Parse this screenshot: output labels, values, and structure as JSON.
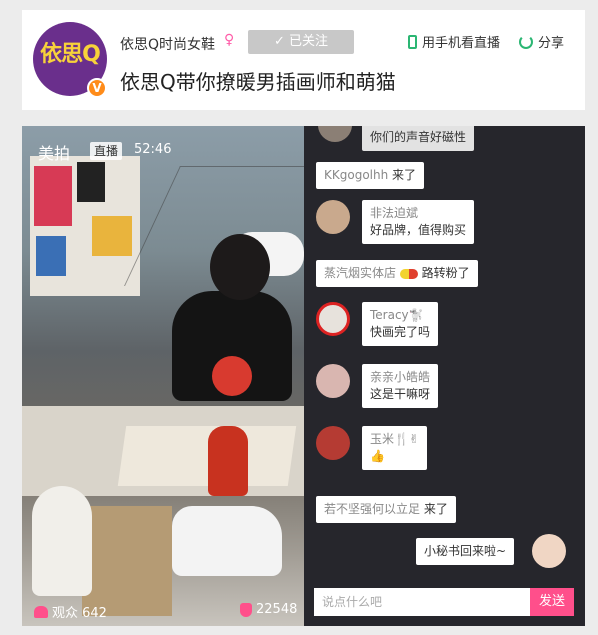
{
  "header": {
    "avatar_text": "依思Q",
    "verified_badge": "V",
    "channel_name": "依思Q时尚女鞋",
    "gender_icon": "♀",
    "follow_label": "✓ 已关注",
    "phone_watch_label": "用手机看直播",
    "share_label": "分享",
    "live_title": "依思Q带你撩暖男插画师和萌猫"
  },
  "video": {
    "brand": "美拍",
    "live_badge": "直播",
    "elapsed": "52:46",
    "viewers_label": "观众 642",
    "likes": "22548"
  },
  "chat": {
    "messages": [
      {
        "user": "",
        "text": "你们的声音好磁性"
      },
      {
        "user": "KKgogolhh",
        "text": "来了"
      },
      {
        "user": "非法迫斌",
        "text": "好品牌，值得购买"
      },
      {
        "user": "蒸汽烟实体店",
        "text": "路转粉了"
      },
      {
        "user": "Teracy🐩",
        "text": "快画完了吗"
      },
      {
        "user": "亲亲小皓皓",
        "text": "这是干嘛呀"
      },
      {
        "user": "玉米🍴✌",
        "text": "👍"
      },
      {
        "user": "若不坚强何以立足",
        "text": "来了"
      },
      {
        "user": "",
        "text": "小秘书回来啦~"
      }
    ],
    "input_placeholder": "说点什么吧",
    "send_label": "发送"
  },
  "colors": {
    "accent_pink": "#ff4f8b",
    "accent_green": "#2bb673",
    "chat_bg": "#26262c",
    "avatar_purple": "#6a2f8c"
  },
  "icons": [
    "phone-icon",
    "share-icon",
    "viewer-icon",
    "like-icon",
    "check-icon",
    "female-icon"
  ]
}
